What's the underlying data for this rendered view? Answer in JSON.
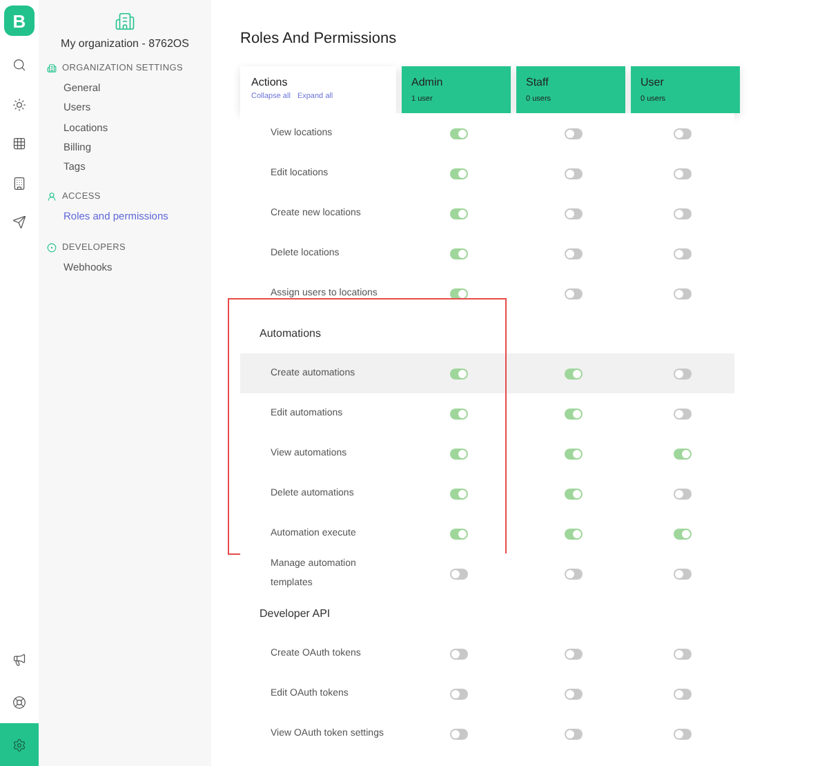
{
  "rail": {
    "logo": "B",
    "items": [
      {
        "kind": "search",
        "selected": false
      },
      {
        "kind": "sun",
        "selected": false
      },
      {
        "kind": "grid",
        "selected": false
      },
      {
        "kind": "building",
        "selected": false
      },
      {
        "kind": "send",
        "selected": false
      }
    ],
    "bottom_items": [
      {
        "kind": "megaphone",
        "selected": false
      },
      {
        "kind": "lifebuoy",
        "selected": false
      },
      {
        "kind": "settings",
        "selected": true
      }
    ]
  },
  "sidebar": {
    "organization": "My organization - 8762OS",
    "sections": [
      {
        "kind": "organization",
        "title": "ORGANIZATION SETTINGS",
        "items": [
          {
            "label": "General",
            "selected": false
          },
          {
            "label": "Users",
            "selected": false
          },
          {
            "label": "Locations",
            "selected": false
          },
          {
            "label": "Billing",
            "selected": false
          },
          {
            "label": "Tags",
            "selected": false
          }
        ]
      },
      {
        "kind": "access",
        "title": "ACCESS",
        "items": [
          {
            "label": "Roles and permissions",
            "selected": true
          }
        ]
      },
      {
        "kind": "developers",
        "title": "DEVELOPERS",
        "items": [
          {
            "label": "Webhooks",
            "selected": false
          }
        ]
      }
    ]
  },
  "page": {
    "title": "Roles And Permissions",
    "actions": {
      "title": "Actions",
      "links": [
        "Collapse all",
        "Expand all"
      ]
    },
    "roles": [
      {
        "name": "Admin",
        "count": "1 user"
      },
      {
        "name": "Staff",
        "count": "0 users"
      },
      {
        "name": "User",
        "count": "0 users"
      }
    ],
    "sections": [
      {
        "highlighted": false,
        "rows": [
          {
            "label": "View locations",
            "hovered": false,
            "permissions": [
              true,
              false,
              false
            ]
          },
          {
            "label": "Edit locations",
            "hovered": false,
            "permissions": [
              true,
              false,
              false
            ]
          },
          {
            "label": "Create new locations",
            "hovered": false,
            "permissions": [
              true,
              false,
              false
            ]
          },
          {
            "label": "Delete locations",
            "hovered": false,
            "permissions": [
              true,
              false,
              false
            ]
          },
          {
            "label": "Assign users to locations",
            "hovered": false,
            "permissions": [
              true,
              false,
              false
            ]
          }
        ]
      },
      {
        "title": "Automations",
        "highlighted": true,
        "rows": [
          {
            "label": "Create automations",
            "hovered": true,
            "permissions": [
              true,
              true,
              false
            ]
          },
          {
            "label": "Edit automations",
            "hovered": false,
            "permissions": [
              true,
              true,
              false
            ]
          },
          {
            "label": "View automations",
            "hovered": false,
            "permissions": [
              true,
              true,
              true
            ]
          },
          {
            "label": "Delete automations",
            "hovered": false,
            "permissions": [
              true,
              true,
              false
            ]
          },
          {
            "label": "Automation execute",
            "hovered": false,
            "permissions": [
              true,
              true,
              true
            ]
          }
        ]
      },
      {
        "highlighted": false,
        "rows": [
          {
            "label": "Manage automation templates",
            "hovered": false,
            "permissions": [
              false,
              false,
              false
            ]
          }
        ]
      },
      {
        "title": "Developer API",
        "highlighted": false,
        "rows": [
          {
            "label": "Create OAuth tokens",
            "hovered": false,
            "permissions": [
              false,
              false,
              false
            ]
          },
          {
            "label": "Edit OAuth tokens",
            "hovered": false,
            "permissions": [
              false,
              false,
              false
            ]
          },
          {
            "label": "View OAuth token settings",
            "hovered": false,
            "permissions": [
              false,
              false,
              false
            ]
          }
        ]
      }
    ]
  }
}
